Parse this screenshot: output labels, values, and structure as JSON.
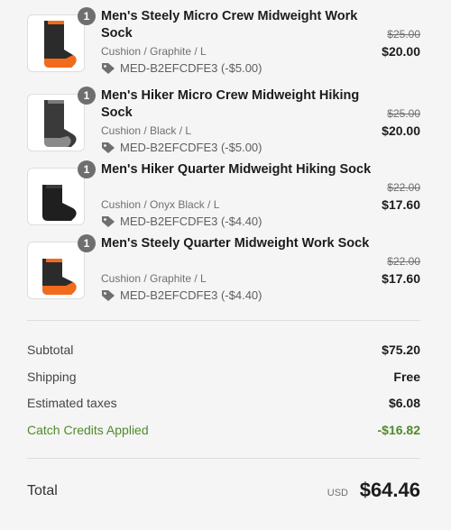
{
  "items": [
    {
      "quantity": "1",
      "name": "Men's Steely Micro Crew Midweight Work Sock",
      "variant": "Cushion / Graphite / L",
      "discount": "MED-B2EFCDFE3 (-$5.00)",
      "original_price": "$25.00",
      "price": "$20.00",
      "colors": {
        "body": "#2b2b2b",
        "accent": "#f26a1b",
        "heel": "#f26a1b"
      }
    },
    {
      "quantity": "1",
      "name": "Men's Hiker Micro Crew Midweight Hiking Sock",
      "variant": "Cushion / Black / L",
      "discount": "MED-B2EFCDFE3 (-$5.00)",
      "original_price": "$25.00",
      "price": "$20.00",
      "colors": {
        "body": "#3a3a3a",
        "accent": "#7a7a7a",
        "heel": "#8a8a8a"
      }
    },
    {
      "quantity": "1",
      "name": "Men's Hiker Quarter Midweight Hiking Sock",
      "variant": "Cushion / Onyx Black / L",
      "discount": "MED-B2EFCDFE3 (-$4.40)",
      "original_price": "$22.00",
      "price": "$17.60",
      "colors": {
        "body": "#1f1f1f",
        "accent": "#3a3a3a",
        "heel": "#2a2a2a"
      }
    },
    {
      "quantity": "1",
      "name": "Men's Steely Quarter Midweight Work Sock",
      "variant": "Cushion / Graphite / L",
      "discount": "MED-B2EFCDFE3 (-$4.40)",
      "original_price": "$22.00",
      "price": "$17.60",
      "colors": {
        "body": "#2b2b2b",
        "accent": "#f26a1b",
        "heel": "#f26a1b"
      }
    }
  ],
  "summary": {
    "subtotal_label": "Subtotal",
    "subtotal_value": "$75.20",
    "shipping_label": "Shipping",
    "shipping_value": "Free",
    "taxes_label": "Estimated taxes",
    "taxes_value": "$6.08",
    "credits_label": "Catch Credits Applied",
    "credits_value": "-$16.82",
    "credits_color": "#4f8a2c"
  },
  "total": {
    "label": "Total",
    "currency": "USD",
    "amount": "$64.46"
  },
  "icons": {
    "discount": "tag-icon",
    "thumbnail": "sock-image"
  }
}
